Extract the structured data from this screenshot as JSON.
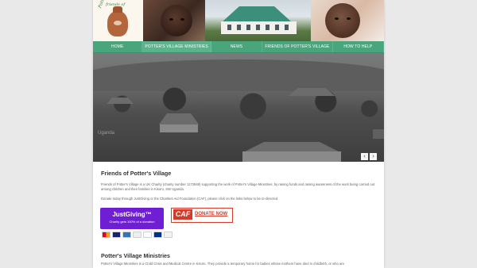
{
  "header": {
    "logo_text_line1": "friends of",
    "logo_text_line2": "Potter's Village"
  },
  "nav": {
    "items": [
      {
        "label": "HOME"
      },
      {
        "label": "POTTER'S VILLAGE MINISTRIES"
      },
      {
        "label": "NEWS"
      },
      {
        "label": "FRIENDS OF POTTER'S VILLAGE"
      },
      {
        "label": "HOW TO HELP"
      }
    ],
    "active_index": 1
  },
  "slider": {
    "caption": "Uganda",
    "prev_icon": "‹",
    "next_icon": "›"
  },
  "friends_section": {
    "title": "Friends of Potter's Village",
    "paragraph1": "Friends of Potter's Village is a UK Charity (charity number 1173948) supporting the work of Potter's Village Ministries, by raising funds and raising awareness of the work being carried out among children and their families in Kisoro, SW Uganda.",
    "paragraph2": "Donate today through JustGiving or the Charities Aid Foundation (CAF), please click on the links below to be re-directed."
  },
  "donate": {
    "justgiving_logo": "JustGiving™",
    "justgiving_sub": "Charity gets 100% of a donation",
    "caf_logo": "CAF",
    "caf_text": "DONATE NOW"
  },
  "ministries_section": {
    "title": "Potter's Village Ministries",
    "paragraph": "Potter's Village Ministries is a Child Crisis and Medical Centre in Kisoro. They provide a temporary home for babies whose mothers have died in childbirth, or who are"
  },
  "colors": {
    "nav_green": "#49a57c",
    "justgiving_purple": "#6f1ed3",
    "caf_red": "#d23a2a"
  }
}
